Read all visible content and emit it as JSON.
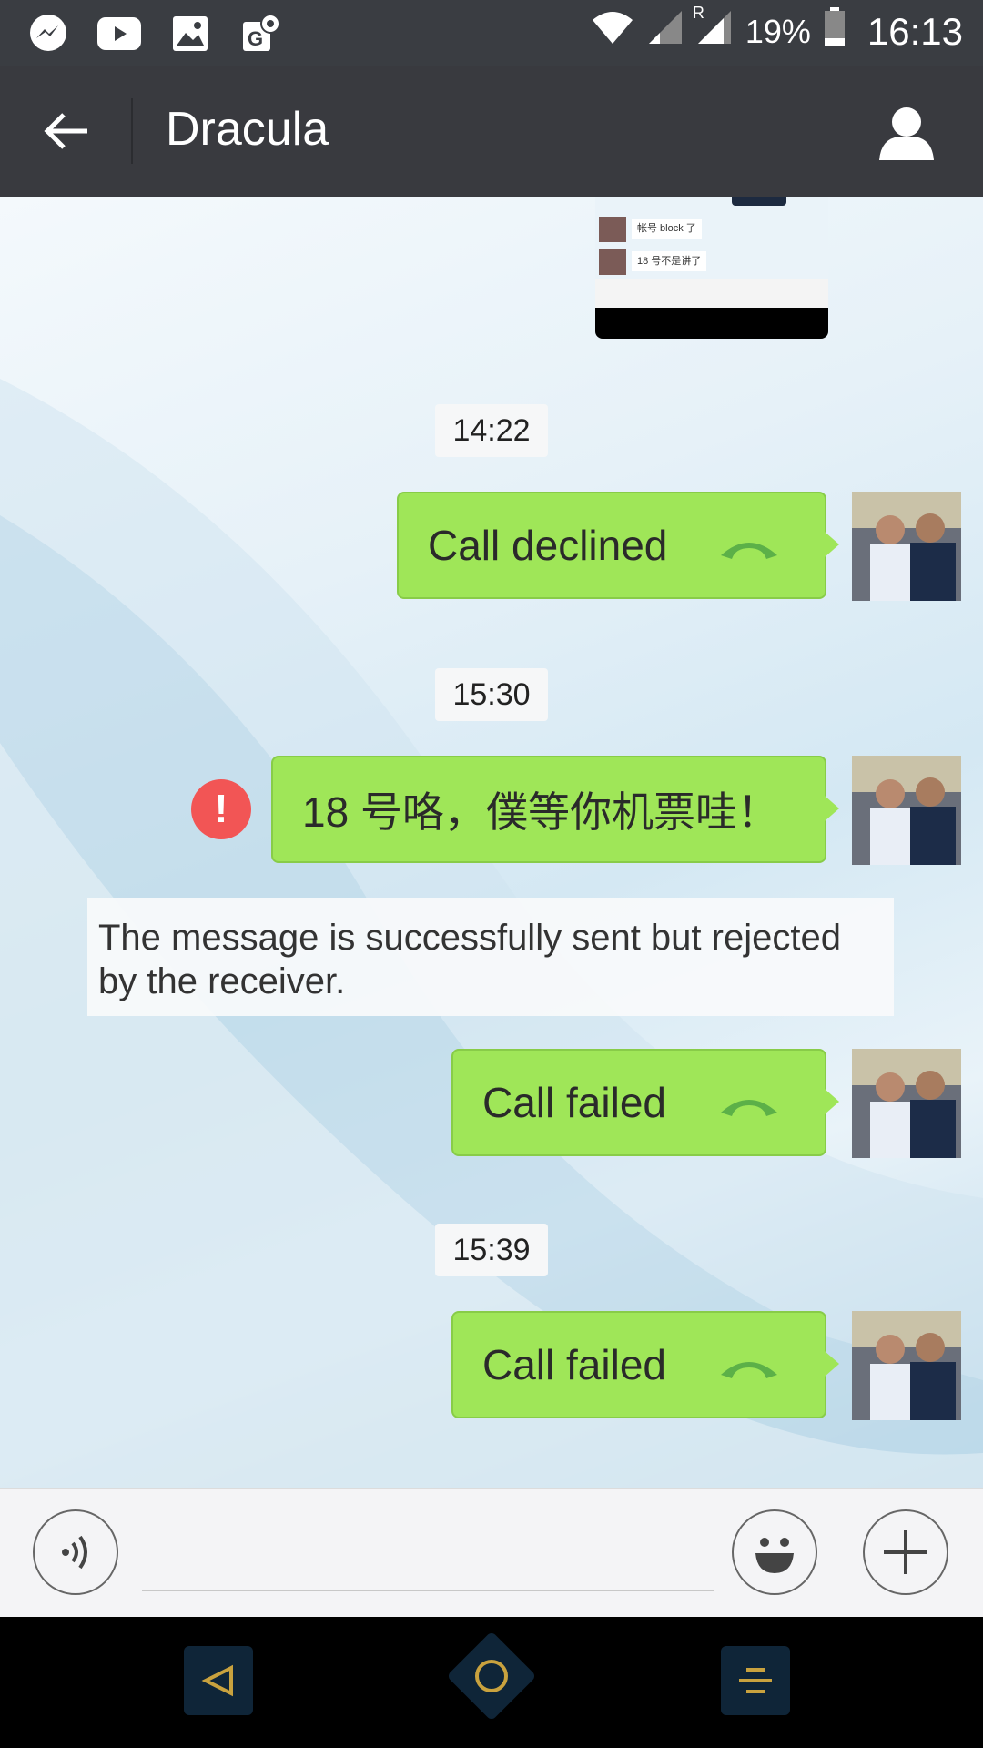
{
  "status_bar": {
    "battery_percent": "19%",
    "time": "16:13",
    "roaming_indicator": "R",
    "icons": [
      "messenger-icon",
      "youtube-icon",
      "gallery-icon",
      "maps-icon",
      "wifi-icon",
      "signal-icon",
      "battery-icon"
    ]
  },
  "header": {
    "title": "Dracula",
    "back_icon": "arrow-left-icon",
    "profile_icon": "person-icon"
  },
  "thumbnail": {
    "messages": [
      "帐号 block 了",
      "18 号不是讲了"
    ]
  },
  "messages": [
    {
      "type": "timestamp",
      "text": "14:22"
    },
    {
      "type": "call",
      "text": "Call declined",
      "icon": "phone-hangup-icon"
    },
    {
      "type": "timestamp",
      "text": "15:30"
    },
    {
      "type": "text",
      "text": "18 号咯，僕等你机票哇！",
      "status": "error"
    },
    {
      "type": "system",
      "text": "The message is successfully sent but rejected by the receiver."
    },
    {
      "type": "call",
      "text": "Call failed",
      "icon": "phone-hangup-icon"
    },
    {
      "type": "timestamp",
      "text": "15:39"
    },
    {
      "type": "call",
      "text": "Call failed",
      "icon": "phone-hangup-icon"
    }
  ],
  "input_bar": {
    "voice_icon": "voice-icon",
    "emoji_icon": "emoji-icon",
    "plus_icon": "plus-icon",
    "text_value": ""
  },
  "colors": {
    "bubble": "#9fe658",
    "header": "#393a3f",
    "error": "#f25555"
  }
}
